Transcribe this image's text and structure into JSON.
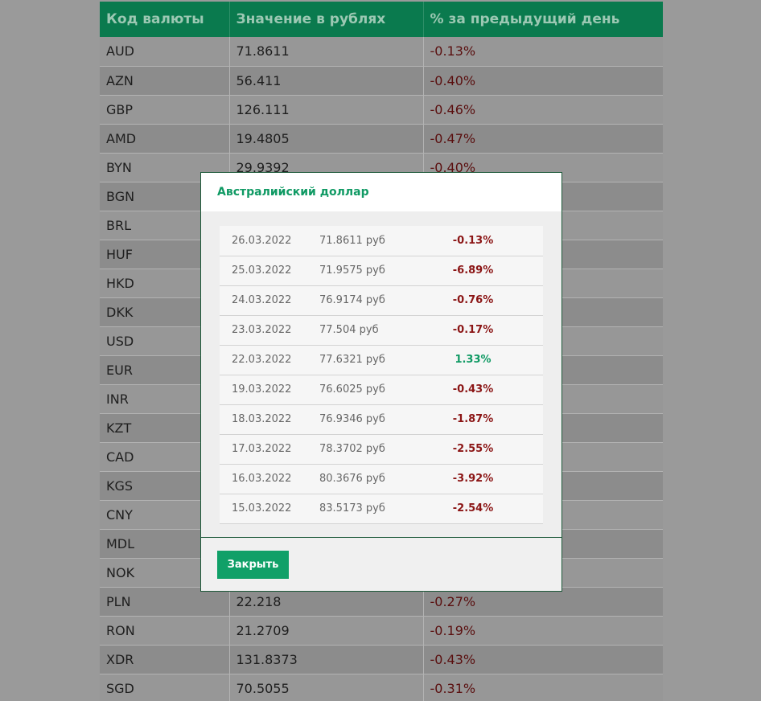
{
  "table": {
    "headers": [
      "Код валюты",
      "Значение в рублях",
      "% за предыдущий день"
    ],
    "rows": [
      {
        "code": "AUD",
        "value": "71.8611",
        "pct": "-0.13%"
      },
      {
        "code": "AZN",
        "value": "56.411",
        "pct": "-0.40%"
      },
      {
        "code": "GBP",
        "value": "126.111",
        "pct": "-0.46%"
      },
      {
        "code": "AMD",
        "value": "19.4805",
        "pct": "-0.47%"
      },
      {
        "code": "BYN",
        "value": "29.9392",
        "pct": "-0.40%"
      },
      {
        "code": "BGN",
        "value": "",
        "pct": ""
      },
      {
        "code": "BRL",
        "value": "",
        "pct": ""
      },
      {
        "code": "HUF",
        "value": "",
        "pct": ""
      },
      {
        "code": "HKD",
        "value": "",
        "pct": ""
      },
      {
        "code": "DKK",
        "value": "",
        "pct": ""
      },
      {
        "code": "USD",
        "value": "",
        "pct": ""
      },
      {
        "code": "EUR",
        "value": "",
        "pct": ""
      },
      {
        "code": "INR",
        "value": "",
        "pct": ""
      },
      {
        "code": "KZT",
        "value": "",
        "pct": ""
      },
      {
        "code": "CAD",
        "value": "",
        "pct": ""
      },
      {
        "code": "KGS",
        "value": "",
        "pct": ""
      },
      {
        "code": "CNY",
        "value": "",
        "pct": ""
      },
      {
        "code": "MDL",
        "value": "",
        "pct": ""
      },
      {
        "code": "NOK",
        "value": "",
        "pct": ""
      },
      {
        "code": "PLN",
        "value": "22.218",
        "pct": "-0.27%"
      },
      {
        "code": "RON",
        "value": "21.2709",
        "pct": "-0.19%"
      },
      {
        "code": "XDR",
        "value": "131.8373",
        "pct": "-0.43%"
      },
      {
        "code": "SGD",
        "value": "70.5055",
        "pct": "-0.31%"
      }
    ]
  },
  "modal": {
    "title": "Австралийский доллар",
    "history": [
      {
        "date": "26.03.2022",
        "value": "71.8611 руб",
        "change": "-0.13%",
        "trend": "neg"
      },
      {
        "date": "25.03.2022",
        "value": "71.9575 руб",
        "change": "-6.89%",
        "trend": "neg"
      },
      {
        "date": "24.03.2022",
        "value": "76.9174 руб",
        "change": "-0.76%",
        "trend": "neg"
      },
      {
        "date": "23.03.2022",
        "value": "77.504 руб",
        "change": "-0.17%",
        "trend": "neg"
      },
      {
        "date": "22.03.2022",
        "value": "77.6321 руб",
        "change": "1.33%",
        "trend": "pos"
      },
      {
        "date": "19.03.2022",
        "value": "76.6025 руб",
        "change": "-0.43%",
        "trend": "neg"
      },
      {
        "date": "18.03.2022",
        "value": "76.9346 руб",
        "change": "-1.87%",
        "trend": "neg"
      },
      {
        "date": "17.03.2022",
        "value": "78.3702 руб",
        "change": "-2.55%",
        "trend": "neg"
      },
      {
        "date": "16.03.2022",
        "value": "80.3676 руб",
        "change": "-3.92%",
        "trend": "neg"
      },
      {
        "date": "15.03.2022",
        "value": "83.5173 руб",
        "change": "-2.54%",
        "trend": "neg"
      }
    ],
    "close_label": "Закрыть"
  },
  "colors": {
    "header_green": "#0a7a4e",
    "accent_green": "#10a068",
    "negative_red": "#8b1515"
  }
}
